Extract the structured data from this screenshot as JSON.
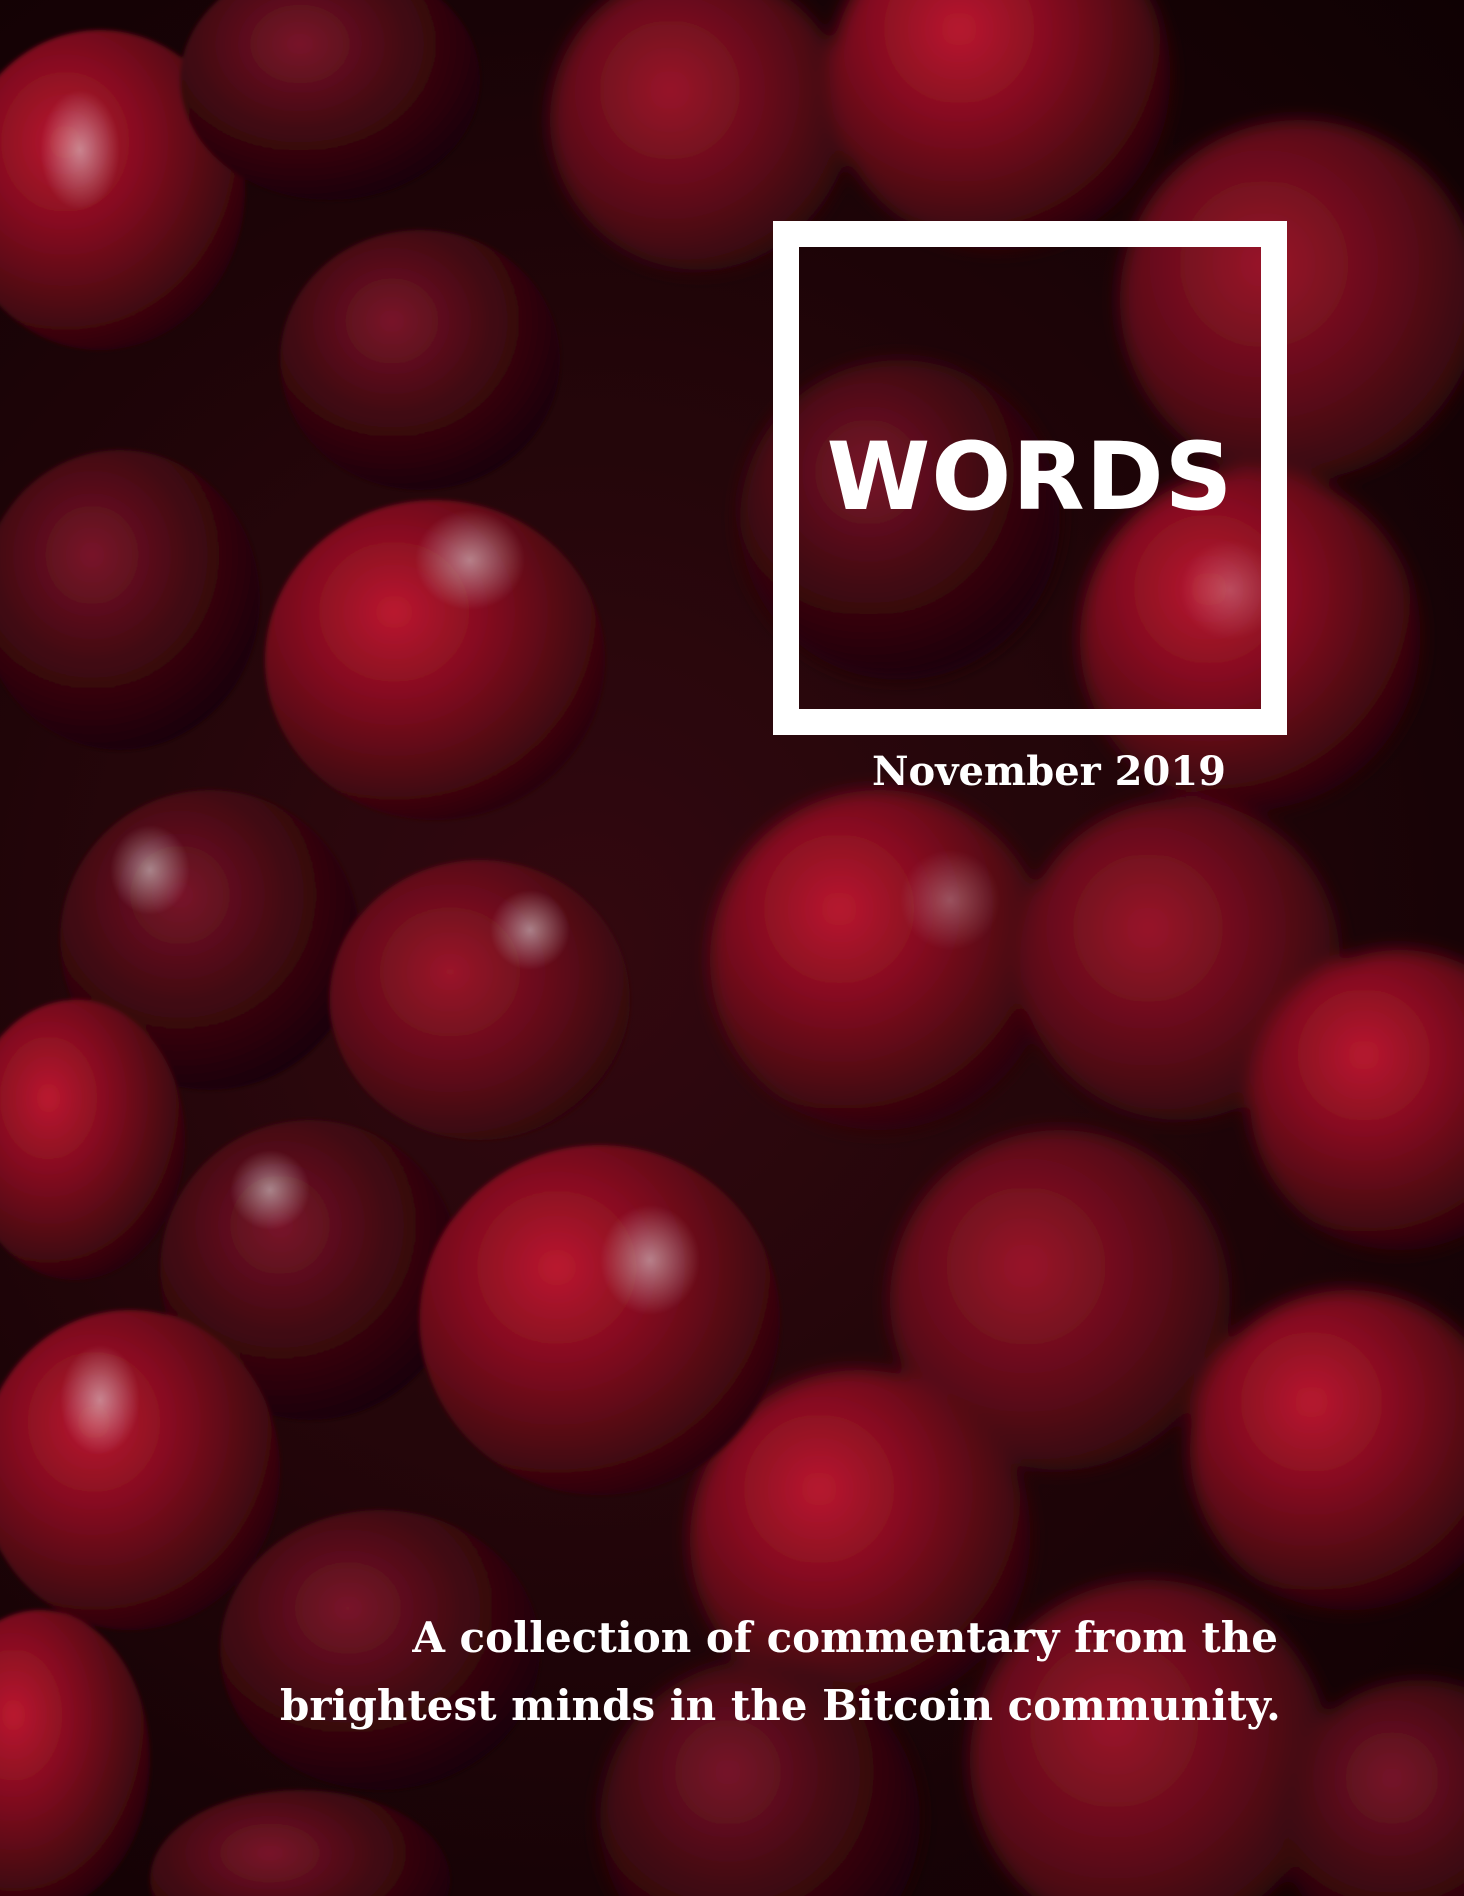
{
  "cover": {
    "title": "WORDS",
    "date": "November 2019",
    "subtitle_lines": [
      "A collection of commentary from the",
      "brightest minds in the Bitcoin community."
    ]
  },
  "background": {
    "subject": "cranberries-photo",
    "colors": {
      "dark": "#1c0407",
      "berry_dark": "#5a0a18",
      "berry": "#a3102a",
      "berry_bright": "#d41c36",
      "frame": "#ffffff"
    }
  }
}
